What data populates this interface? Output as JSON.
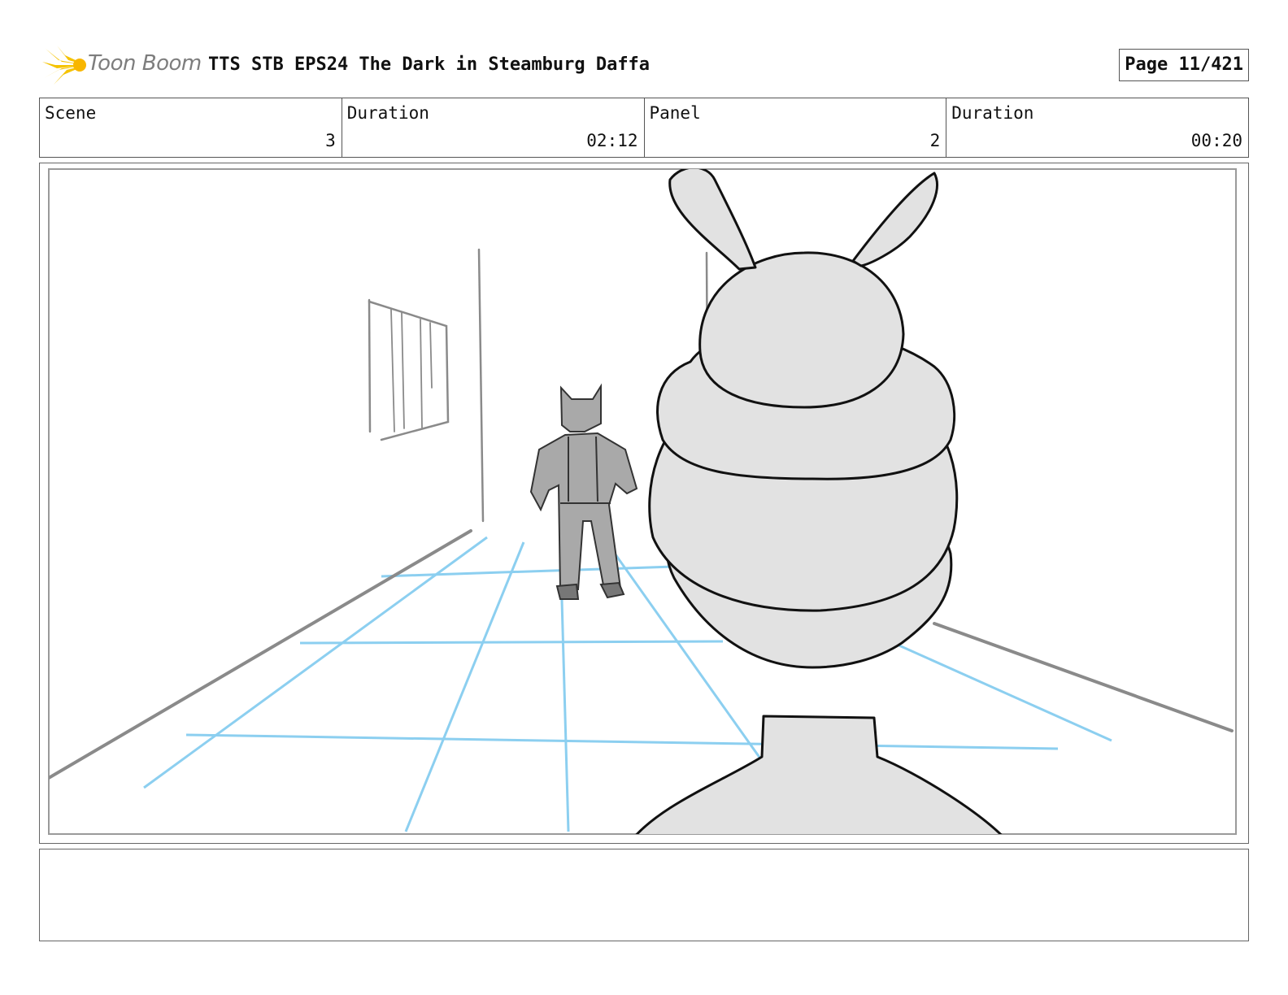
{
  "header": {
    "logo_text": "Toon Boom",
    "title": "TTS STB EPS24 The Dark in Steamburg Daffa",
    "page": "Page  11/421"
  },
  "info": {
    "scene_label": "Scene",
    "scene_value": "3",
    "scene_duration_label": "Duration",
    "scene_duration_value": "02:12",
    "panel_label": "Panel",
    "panel_value": "2",
    "panel_duration_label": "Duration",
    "panel_duration_value": "00:20"
  },
  "notes": {
    "text": ""
  },
  "colors": {
    "logo_accent": "#f5c300",
    "guide_lines": "#8ccff0",
    "sketch_gray": "#8a8a8a",
    "character_fill": "#e2e2e2"
  }
}
